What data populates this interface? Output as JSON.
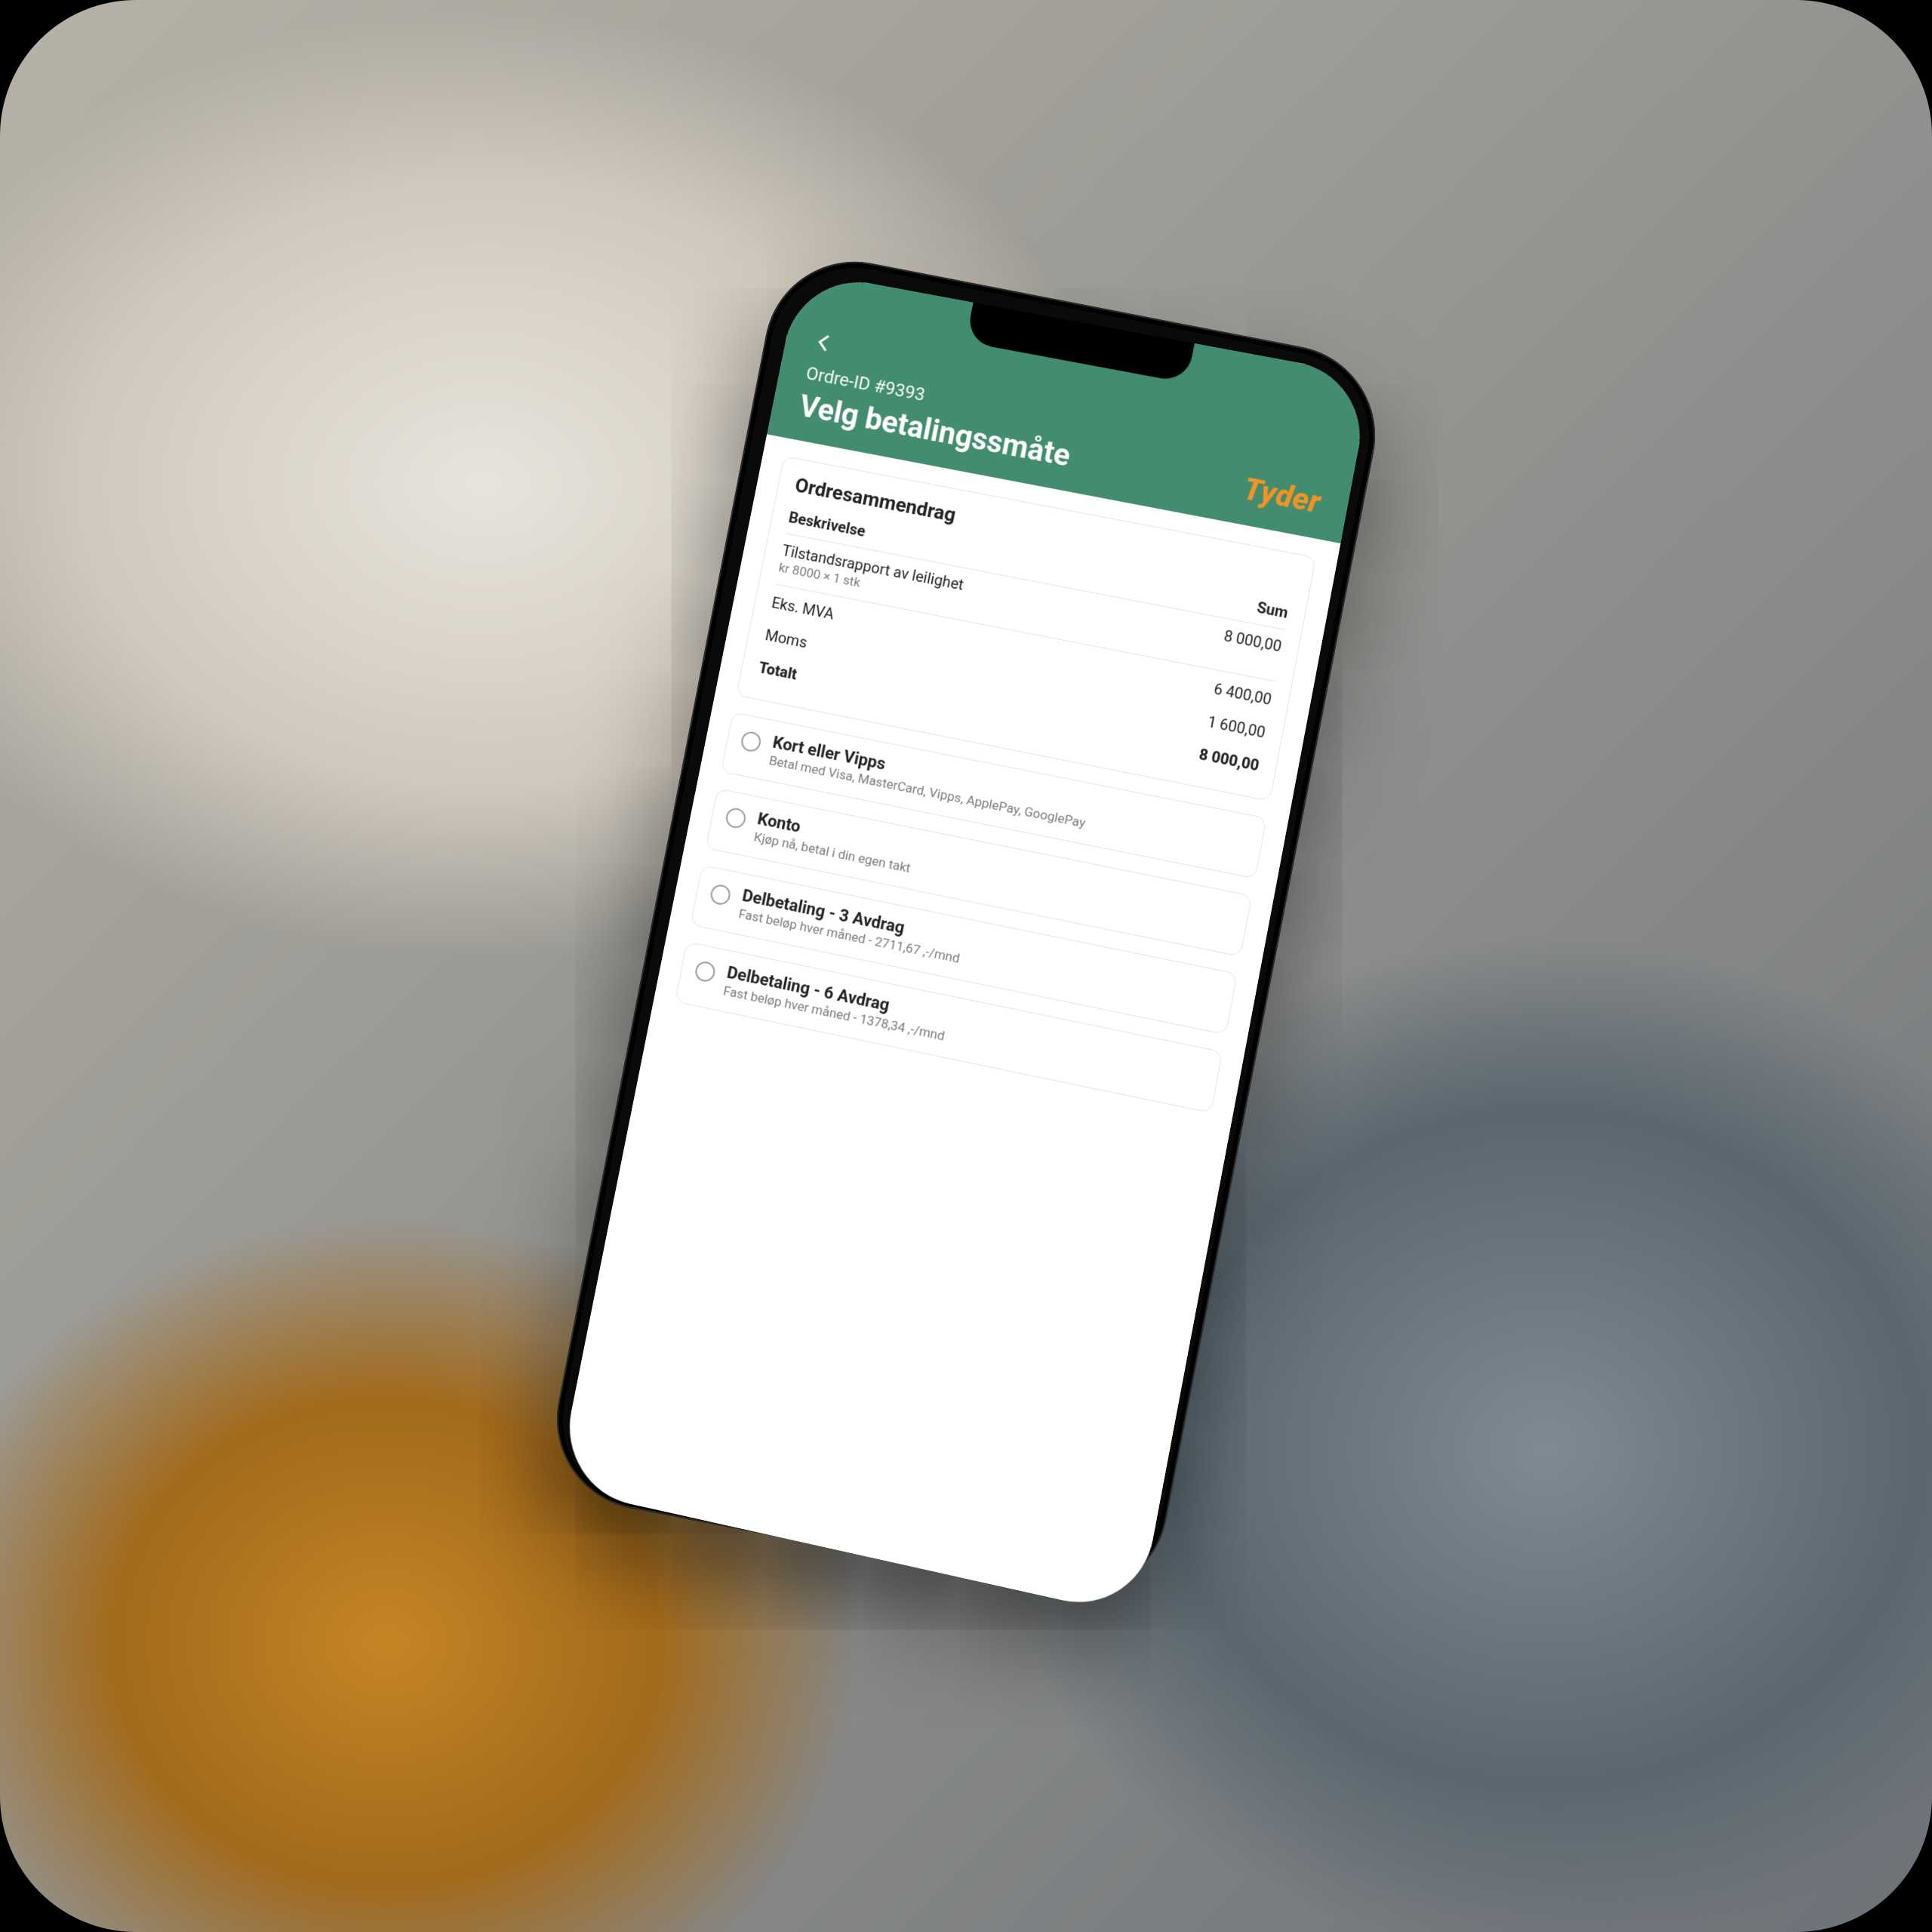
{
  "colors": {
    "header": "#3f8e6f",
    "brand": "#f6921e"
  },
  "header": {
    "order_id": "Ordre-ID #9393",
    "title": "Velg betalingssmåte",
    "brand": "Tyder"
  },
  "summary": {
    "heading": "Ordresammendrag",
    "col_desc": "Beskrivelse",
    "col_sum": "Sum",
    "item": {
      "title": "Tilstandsrapport av leilighet",
      "qty": "kr 8000 × 1 stk",
      "amount": "8 000,00"
    },
    "ex_vat_label": "Eks. MVA",
    "ex_vat_value": "6 400,00",
    "vat_label": "Moms",
    "vat_value": "1 600,00",
    "total_label": "Totalt",
    "total_value": "8 000,00"
  },
  "options": [
    {
      "title": "Kort eller Vipps",
      "sub": "Betal med Visa, MasterCard, Vipps, ApplePay, GooglePay"
    },
    {
      "title": "Konto",
      "sub": "Kjøp nå, betal i din egen takt"
    },
    {
      "title": "Delbetaling - 3 Avdrag",
      "sub": "Fast beløp hver måned - 2711,67 ,-/mnd"
    },
    {
      "title": "Delbetaling - 6 Avdrag",
      "sub": "Fast beløp hver måned - 1378,34 ,-/mnd"
    }
  ]
}
